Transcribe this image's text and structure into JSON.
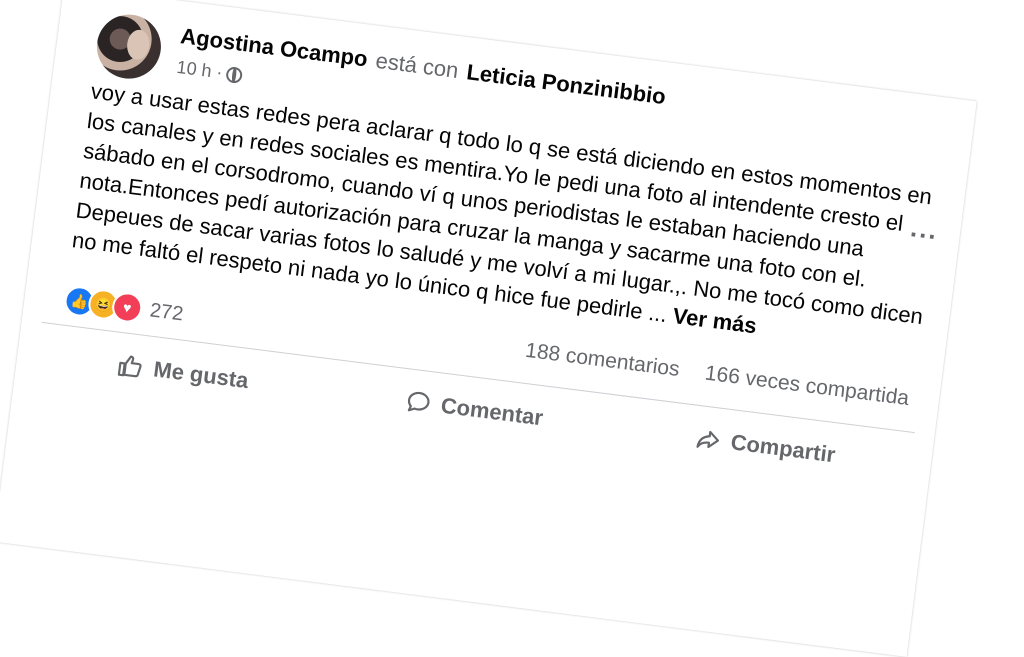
{
  "post": {
    "author": "Agostina Ocampo",
    "with_text": "está con",
    "tagged": "Leticia Ponzinibbio",
    "time": "10 h ·",
    "body": "voy a usar estas redes pera aclarar q todo lo q se está diciendo en estos momentos en los canales y en redes sociales es mentira.Yo le pedi una foto al intendente cresto el sábado en el corsodromo, cuando ví q unos periodistas le estaban haciendo una nota.Entonces pedí autorización para cruzar la manga y sacarme una foto con el. Depeues de sacar varias fotos lo saludé y me volví a mi lugar.,. No me tocó como dicen no me faltó el respeto ni nada yo lo único q hice fue pedirle ...",
    "see_more": "Ver más",
    "more_icon": "..."
  },
  "stats": {
    "reaction_count": "272",
    "comments": "188 comentarios",
    "shares": "166 veces compartida"
  },
  "actions": {
    "like": "Me gusta",
    "comment": "Comentar",
    "share": "Compartir"
  },
  "colors": {
    "like_blue": "#1877f2",
    "haha_yellow": "#f7b125",
    "love_red": "#f33e58",
    "secondary_text": "#65676b"
  }
}
